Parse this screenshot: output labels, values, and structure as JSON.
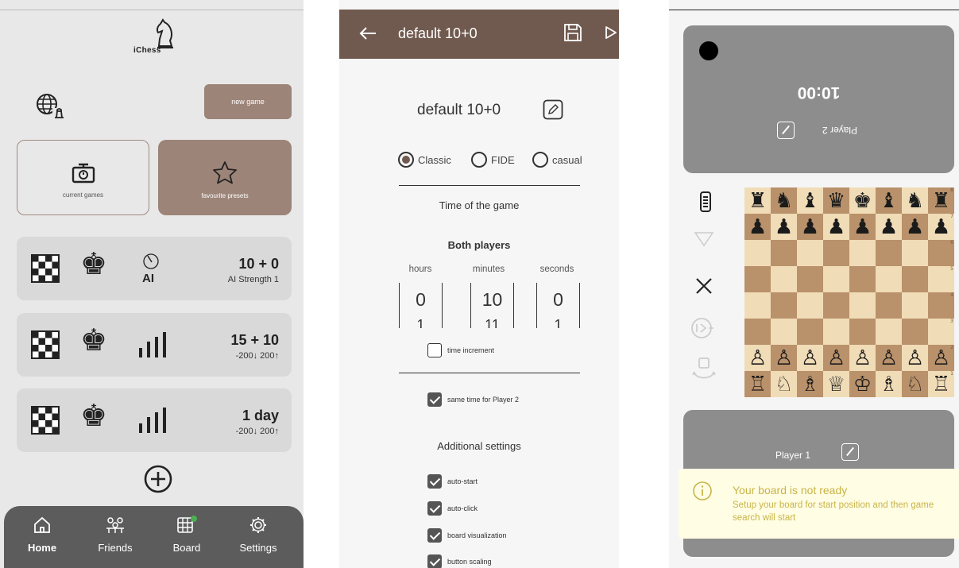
{
  "home": {
    "logo_text": "iChess",
    "new_game_label": "new game",
    "current_games_label": "current games",
    "favourite_presets_label": "favourite presets",
    "presets": [
      {
        "title": "10 + 0",
        "subtitle": "AI Strength 1",
        "opponent_label": "AI"
      },
      {
        "title": "15 + 10",
        "subtitle": "-200↓ 200↑"
      },
      {
        "title": "1 day",
        "subtitle": "-200↓ 200↑"
      }
    ],
    "nav": [
      {
        "label": "Home",
        "icon": "home-icon",
        "active": true
      },
      {
        "label": "Friends",
        "icon": "friends-icon"
      },
      {
        "label": "Board",
        "icon": "board-icon",
        "status_dot_color": "#4caf50"
      },
      {
        "label": "Settings",
        "icon": "settings-icon"
      }
    ],
    "colors": {
      "accent": "#9c8478",
      "nav_bg": "#5c5c5c"
    }
  },
  "preset_editor": {
    "header_title": "default 10+0",
    "preset_name": "default 10+0",
    "modes": [
      {
        "label": "Classic",
        "selected": true
      },
      {
        "label": "FIDE",
        "selected": false
      },
      {
        "label": "casual",
        "selected": false
      }
    ],
    "time_section_title": "Time of the game",
    "both_players_label": "Both players",
    "wheel_labels": {
      "hours": "hours",
      "minutes": "minutes",
      "seconds": "seconds"
    },
    "wheel_values": {
      "hours": "0",
      "minutes": "10",
      "seconds": "0"
    },
    "wheel_next": {
      "hours": "1",
      "minutes": "11",
      "seconds": "1"
    },
    "time_increment_label": "time increment",
    "time_increment_checked": false,
    "same_time_label": "same time for Player 2",
    "same_time_checked": true,
    "additional_title": "Additional settings",
    "additional": [
      {
        "label": "auto-start",
        "checked": true
      },
      {
        "label": "auto-click",
        "checked": true
      },
      {
        "label": "board visualization",
        "checked": true
      },
      {
        "label": "button scaling",
        "checked": true
      }
    ],
    "colors": {
      "header_bg": "#705a4f"
    }
  },
  "game": {
    "opponent_clock": "10:00",
    "opponent_name": "Player 2",
    "player_name": "Player 1",
    "ranks": [
      "8",
      "7",
      "6",
      "5",
      "4",
      "3",
      "2",
      "1"
    ],
    "board": [
      [
        "♜",
        "♞",
        "♝",
        "♛",
        "♚",
        "♝",
        "♞",
        "♜"
      ],
      [
        "♟",
        "♟",
        "♟",
        "♟",
        "♟",
        "♟",
        "♟",
        "♟"
      ],
      [
        "",
        "",
        "",
        "",
        "",
        "",
        "",
        ""
      ],
      [
        "",
        "",
        "",
        "",
        "",
        "",
        "",
        ""
      ],
      [
        "",
        "",
        "",
        "",
        "",
        "",
        "",
        ""
      ],
      [
        "",
        "",
        "",
        "",
        "",
        "",
        "",
        ""
      ],
      [
        "♙",
        "♙",
        "♙",
        "♙",
        "♙",
        "♙",
        "♙",
        "♙"
      ],
      [
        "♖",
        "♘",
        "♗",
        "♕",
        "♔",
        "♗",
        "♘",
        "♖"
      ]
    ],
    "toast_title": "Your board is not ready",
    "toast_message": "Setup your board for start position and then game search will start",
    "colors": {
      "light_square": "#f0dcb7",
      "dark_square": "#b9916a",
      "panel": "#8d8d8d",
      "toast_text": "#c8b449"
    }
  }
}
